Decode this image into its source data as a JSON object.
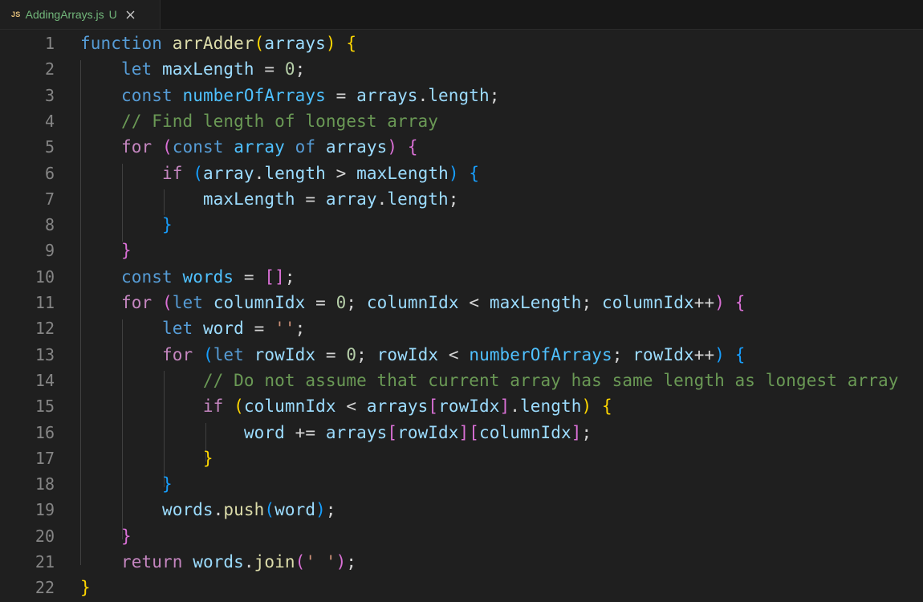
{
  "tab": {
    "icon_text": "JS",
    "filename": "AddingArrays.js",
    "git_status": "U",
    "close_icon": "close-icon"
  },
  "colors": {
    "keyword": "#569cd6",
    "control": "#c586c0",
    "function": "#dcdcaa",
    "variable": "#9cdcfe",
    "constant": "#4fc1ff",
    "number": "#b5cea8",
    "string": "#ce9178",
    "comment": "#6a9955",
    "bracket_level1": "#ffd700",
    "bracket_level2": "#da70d6",
    "bracket_level3": "#179fff"
  },
  "editor": {
    "line_numbers": [
      "1",
      "2",
      "3",
      "4",
      "5",
      "6",
      "7",
      "8",
      "9",
      "10",
      "11",
      "12",
      "13",
      "14",
      "15",
      "16",
      "17",
      "18",
      "19",
      "20",
      "21",
      "22"
    ],
    "lines": [
      [
        [
          "kw",
          "function"
        ],
        [
          "pl",
          " "
        ],
        [
          "fn",
          "arrAdder"
        ],
        [
          "b1",
          "("
        ],
        [
          "var",
          "arrays"
        ],
        [
          "b1",
          ")"
        ],
        [
          "pl",
          " "
        ],
        [
          "b1",
          "{"
        ]
      ],
      [
        [
          "pl",
          "    "
        ],
        [
          "kw",
          "let"
        ],
        [
          "pl",
          " "
        ],
        [
          "var",
          "maxLength"
        ],
        [
          "pl",
          " = "
        ],
        [
          "num",
          "0"
        ],
        [
          "pl",
          ";"
        ]
      ],
      [
        [
          "pl",
          "    "
        ],
        [
          "kw",
          "const"
        ],
        [
          "pl",
          " "
        ],
        [
          "cst",
          "numberOfArrays"
        ],
        [
          "pl",
          " = "
        ],
        [
          "var",
          "arrays"
        ],
        [
          "pl",
          "."
        ],
        [
          "var",
          "length"
        ],
        [
          "pl",
          ";"
        ]
      ],
      [
        [
          "pl",
          "    "
        ],
        [
          "cmt",
          "// Find length of longest array"
        ]
      ],
      [
        [
          "pl",
          "    "
        ],
        [
          "ctl",
          "for"
        ],
        [
          "pl",
          " "
        ],
        [
          "b2",
          "("
        ],
        [
          "kw",
          "const"
        ],
        [
          "pl",
          " "
        ],
        [
          "cst",
          "array"
        ],
        [
          "pl",
          " "
        ],
        [
          "kw",
          "of"
        ],
        [
          "pl",
          " "
        ],
        [
          "var",
          "arrays"
        ],
        [
          "b2",
          ")"
        ],
        [
          "pl",
          " "
        ],
        [
          "b2",
          "{"
        ]
      ],
      [
        [
          "pl",
          "        "
        ],
        [
          "ctl",
          "if"
        ],
        [
          "pl",
          " "
        ],
        [
          "b3",
          "("
        ],
        [
          "var",
          "array"
        ],
        [
          "pl",
          "."
        ],
        [
          "var",
          "length"
        ],
        [
          "pl",
          " > "
        ],
        [
          "var",
          "maxLength"
        ],
        [
          "b3",
          ")"
        ],
        [
          "pl",
          " "
        ],
        [
          "b3",
          "{"
        ]
      ],
      [
        [
          "pl",
          "            "
        ],
        [
          "var",
          "maxLength"
        ],
        [
          "pl",
          " = "
        ],
        [
          "var",
          "array"
        ],
        [
          "pl",
          "."
        ],
        [
          "var",
          "length"
        ],
        [
          "pl",
          ";"
        ]
      ],
      [
        [
          "pl",
          "        "
        ],
        [
          "b3",
          "}"
        ]
      ],
      [
        [
          "pl",
          "    "
        ],
        [
          "b2",
          "}"
        ]
      ],
      [
        [
          "pl",
          "    "
        ],
        [
          "kw",
          "const"
        ],
        [
          "pl",
          " "
        ],
        [
          "cst",
          "words"
        ],
        [
          "pl",
          " = "
        ],
        [
          "b2",
          "[]"
        ],
        [
          "pl",
          ";"
        ]
      ],
      [
        [
          "pl",
          "    "
        ],
        [
          "ctl",
          "for"
        ],
        [
          "pl",
          " "
        ],
        [
          "b2",
          "("
        ],
        [
          "kw",
          "let"
        ],
        [
          "pl",
          " "
        ],
        [
          "var",
          "columnIdx"
        ],
        [
          "pl",
          " = "
        ],
        [
          "num",
          "0"
        ],
        [
          "pl",
          "; "
        ],
        [
          "var",
          "columnIdx"
        ],
        [
          "pl",
          " < "
        ],
        [
          "var",
          "maxLength"
        ],
        [
          "pl",
          "; "
        ],
        [
          "var",
          "columnIdx"
        ],
        [
          "pl",
          "++"
        ],
        [
          "b2",
          ")"
        ],
        [
          "pl",
          " "
        ],
        [
          "b2",
          "{"
        ]
      ],
      [
        [
          "pl",
          "        "
        ],
        [
          "kw",
          "let"
        ],
        [
          "pl",
          " "
        ],
        [
          "var",
          "word"
        ],
        [
          "pl",
          " = "
        ],
        [
          "str",
          "''"
        ],
        [
          "pl",
          ";"
        ]
      ],
      [
        [
          "pl",
          "        "
        ],
        [
          "ctl",
          "for"
        ],
        [
          "pl",
          " "
        ],
        [
          "b3",
          "("
        ],
        [
          "kw",
          "let"
        ],
        [
          "pl",
          " "
        ],
        [
          "var",
          "rowIdx"
        ],
        [
          "pl",
          " = "
        ],
        [
          "num",
          "0"
        ],
        [
          "pl",
          "; "
        ],
        [
          "var",
          "rowIdx"
        ],
        [
          "pl",
          " < "
        ],
        [
          "cst",
          "numberOfArrays"
        ],
        [
          "pl",
          "; "
        ],
        [
          "var",
          "rowIdx"
        ],
        [
          "pl",
          "++"
        ],
        [
          "b3",
          ")"
        ],
        [
          "pl",
          " "
        ],
        [
          "b3",
          "{"
        ]
      ],
      [
        [
          "pl",
          "            "
        ],
        [
          "cmt",
          "// Do not assume that current array has same length as longest array"
        ]
      ],
      [
        [
          "pl",
          "            "
        ],
        [
          "ctl",
          "if"
        ],
        [
          "pl",
          " "
        ],
        [
          "b1",
          "("
        ],
        [
          "var",
          "columnIdx"
        ],
        [
          "pl",
          " < "
        ],
        [
          "var",
          "arrays"
        ],
        [
          "b2",
          "["
        ],
        [
          "var",
          "rowIdx"
        ],
        [
          "b2",
          "]"
        ],
        [
          "pl",
          "."
        ],
        [
          "var",
          "length"
        ],
        [
          "b1",
          ")"
        ],
        [
          "pl",
          " "
        ],
        [
          "b1",
          "{"
        ]
      ],
      [
        [
          "pl",
          "                "
        ],
        [
          "var",
          "word"
        ],
        [
          "pl",
          " += "
        ],
        [
          "var",
          "arrays"
        ],
        [
          "b2",
          "["
        ],
        [
          "var",
          "rowIdx"
        ],
        [
          "b2",
          "]"
        ],
        [
          "b2",
          "["
        ],
        [
          "var",
          "columnIdx"
        ],
        [
          "b2",
          "]"
        ],
        [
          "pl",
          ";"
        ]
      ],
      [
        [
          "pl",
          "            "
        ],
        [
          "b1",
          "}"
        ]
      ],
      [
        [
          "pl",
          "        "
        ],
        [
          "b3",
          "}"
        ]
      ],
      [
        [
          "pl",
          "        "
        ],
        [
          "var",
          "words"
        ],
        [
          "pl",
          "."
        ],
        [
          "fn",
          "push"
        ],
        [
          "b3",
          "("
        ],
        [
          "var",
          "word"
        ],
        [
          "b3",
          ")"
        ],
        [
          "pl",
          ";"
        ]
      ],
      [
        [
          "pl",
          "    "
        ],
        [
          "b2",
          "}"
        ]
      ],
      [
        [
          "pl",
          "    "
        ],
        [
          "ctl",
          "return"
        ],
        [
          "pl",
          " "
        ],
        [
          "var",
          "words"
        ],
        [
          "pl",
          "."
        ],
        [
          "fn",
          "join"
        ],
        [
          "b2",
          "("
        ],
        [
          "str",
          "' '"
        ],
        [
          "b2",
          ")"
        ],
        [
          "pl",
          ";"
        ]
      ],
      [
        [
          "b1",
          "}"
        ]
      ]
    ]
  }
}
